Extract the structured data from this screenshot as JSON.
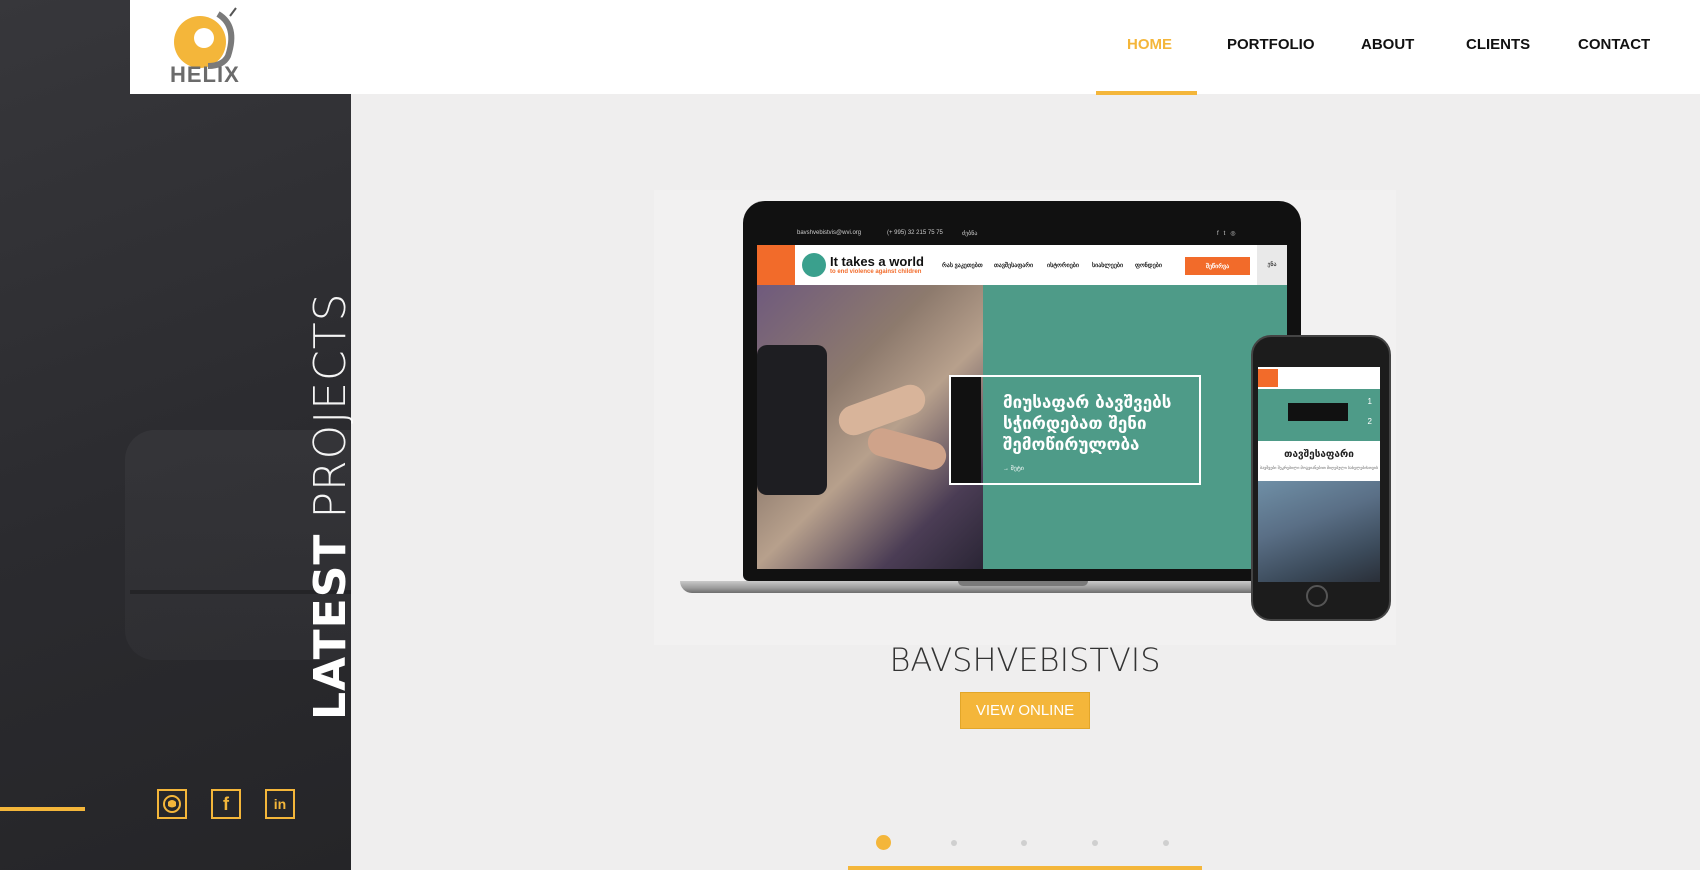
{
  "brand": {
    "logo_text": "HELIX",
    "accent": "#f4b63a"
  },
  "nav": {
    "home": "HOME",
    "portfolio": "PORTFOLIO",
    "about": "ABOUT",
    "clients": "CLIENTS",
    "contact": "CONTACT",
    "active": "HOME"
  },
  "sidebar": {
    "heading_bold": "LATEST",
    "heading_light": "PROJECTS",
    "social": [
      {
        "icon": "github-icon"
      },
      {
        "icon": "facebook-icon"
      },
      {
        "icon": "linkedin-icon"
      }
    ]
  },
  "slide": {
    "project_title": "BAVSHVEBISTVIS",
    "button_label": "VIEW ONLINE",
    "preview": {
      "topbar_email": "bavshvebistvis@wvi.org",
      "topbar_phone": "(+ 995) 32 215 75 75",
      "topbar_misc": "ძებნა",
      "logo_title": "It takes a world",
      "logo_sub": "to end violence against children",
      "menu": [
        "რას ვაკეთებთ",
        "თავშესაფარი",
        "ისტორიები",
        "სიახლეები",
        "ფონდები"
      ],
      "donate": "შეწირვა",
      "lang": "ენა",
      "hero_title": "მიუსაფარ ბავშვებს სჭირდებათ შენი შემოწირულობა",
      "hero_more": "→ მეტი",
      "phone_heading": "თავშესაფარი",
      "phone_sub": "ბავშვები შეკრებილი მოგვიანებით მიღებული სახელებისთვის",
      "phone_slide_1": "1",
      "phone_slide_2": "2"
    }
  },
  "carousel": {
    "count": 5,
    "active_index": 0
  }
}
